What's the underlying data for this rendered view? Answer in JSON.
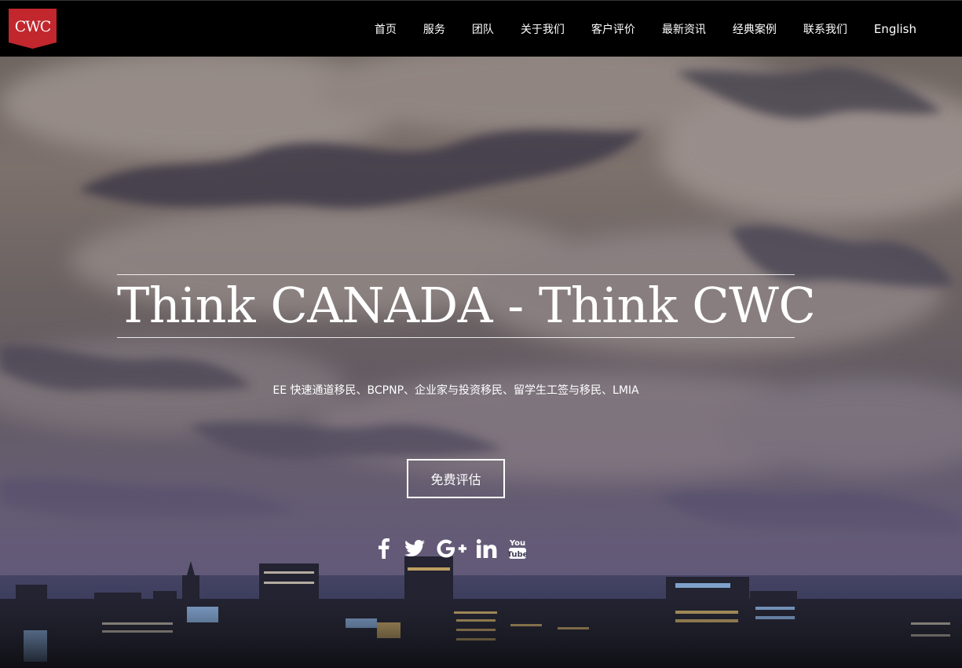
{
  "header": {
    "logo_text": "CWC",
    "nav": [
      {
        "label": "首页"
      },
      {
        "label": "服务"
      },
      {
        "label": "团队"
      },
      {
        "label": "关于我们"
      },
      {
        "label": "客户评价"
      },
      {
        "label": "最新资讯"
      },
      {
        "label": "经典案例"
      },
      {
        "label": "联系我们"
      },
      {
        "label": "English"
      }
    ]
  },
  "hero": {
    "headline": "Think CANADA - Think CWC",
    "subline": "EE 快速通道移民、BCPNP、企业家与投资移民、留学生工签与移民、LMIA",
    "cta_label": "免费评估",
    "social_icons": [
      "facebook-icon",
      "twitter-icon",
      "google-plus-icon",
      "linkedin-icon",
      "youtube-icon"
    ]
  },
  "colors": {
    "topbar_bg": "#000000",
    "logo_red": "#c1272d",
    "text": "#ffffff"
  }
}
